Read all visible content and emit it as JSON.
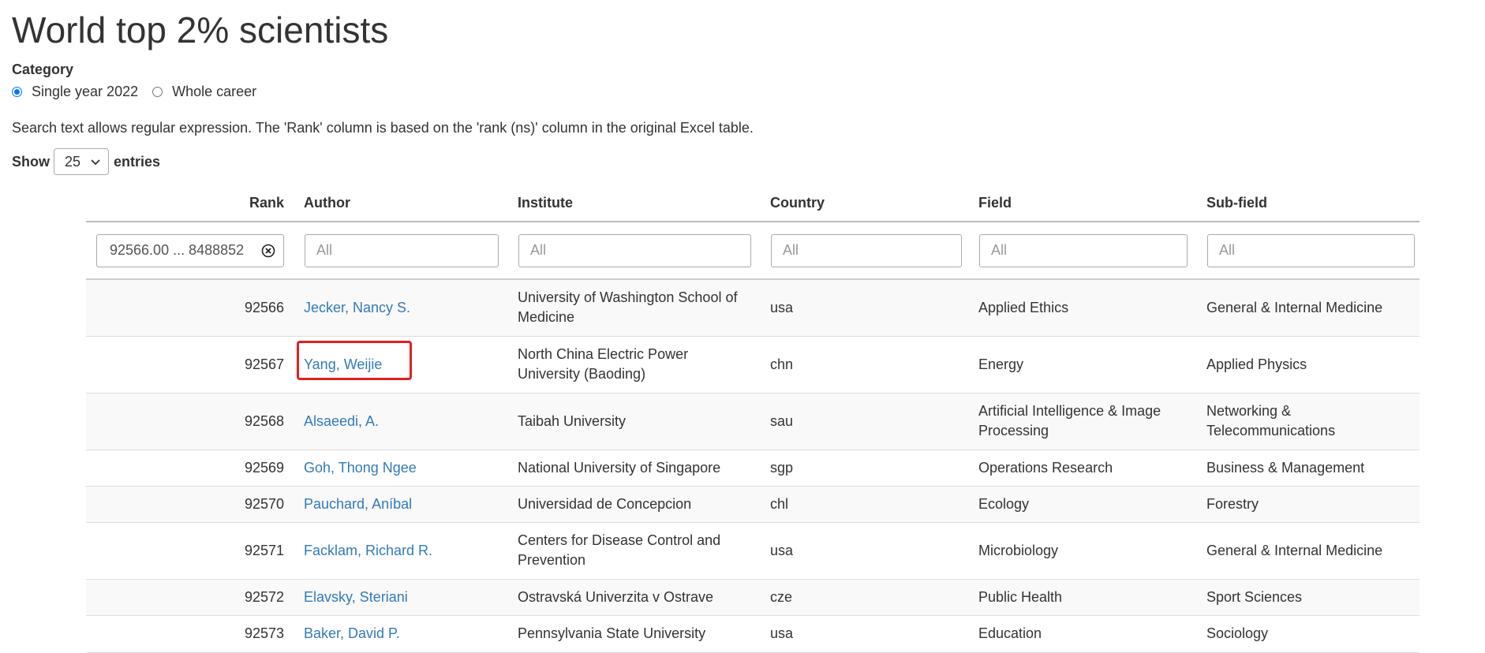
{
  "page": {
    "title": "World top 2% scientists",
    "category_label": "Category",
    "radios": [
      {
        "label": "Single year 2022",
        "checked": true
      },
      {
        "label": "Whole career",
        "checked": false
      }
    ],
    "info_text": "Search text allows regular expression. The 'Rank' column is based on the 'rank (ns)' column in the original Excel table.",
    "show_label": "Show",
    "entries_label": "entries",
    "page_length": "25"
  },
  "table": {
    "headers": [
      "Rank",
      "Author",
      "Institute",
      "Country",
      "Field",
      "Sub-field"
    ],
    "filters": {
      "rank": "92566.00 ... 8488852",
      "placeholder": "All"
    },
    "rows": [
      {
        "rank": "92566",
        "author": "Jecker, Nancy S.",
        "institute": "University of Washington School of Medicine",
        "country": "usa",
        "field": "Applied Ethics",
        "subfield": "General & Internal Medicine"
      },
      {
        "rank": "92567",
        "author": "Yang, Weijie",
        "institute": "North China Electric Power University (Baoding)",
        "country": "chn",
        "field": "Energy",
        "subfield": "Applied Physics"
      },
      {
        "rank": "92568",
        "author": "Alsaeedi, A.",
        "institute": "Taibah University",
        "country": "sau",
        "field": "Artificial Intelligence & Image Processing",
        "subfield": "Networking & Telecommunications"
      },
      {
        "rank": "92569",
        "author": "Goh, Thong Ngee",
        "institute": "National University of Singapore",
        "country": "sgp",
        "field": "Operations Research",
        "subfield": "Business & Management"
      },
      {
        "rank": "92570",
        "author": "Pauchard, Aníbal",
        "institute": "Universidad de Concepcion",
        "country": "chl",
        "field": "Ecology",
        "subfield": "Forestry"
      },
      {
        "rank": "92571",
        "author": "Facklam, Richard R.",
        "institute": "Centers for Disease Control and Prevention",
        "country": "usa",
        "field": "Microbiology",
        "subfield": "General & Internal Medicine"
      },
      {
        "rank": "92572",
        "author": "Elavsky, Steriani",
        "institute": "Ostravská Univerzita v Ostrave",
        "country": "cze",
        "field": "Public Health",
        "subfield": "Sport Sciences"
      },
      {
        "rank": "92573",
        "author": "Baker, David P.",
        "institute": "Pennsylvania State University",
        "country": "usa",
        "field": "Education",
        "subfield": "Sociology"
      }
    ]
  },
  "colors": {
    "link": "#337ab7",
    "highlight": "#e02020",
    "radio": "#0075ff"
  }
}
